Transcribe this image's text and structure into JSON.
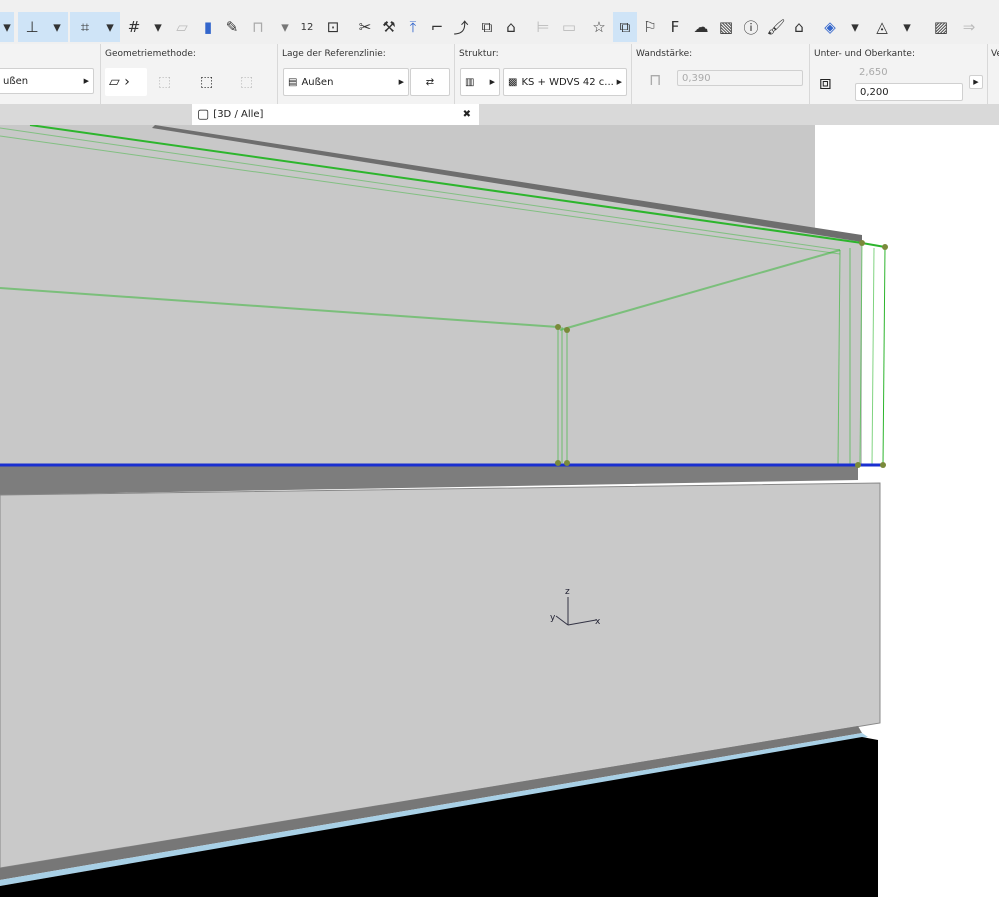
{
  "toolbar": {
    "icons": [
      "dropdown-arrow",
      "guide-line",
      "dropdown-arrow",
      "coordinate-input",
      "dropdown-arrow",
      "grid-snap",
      "dropdown-arrow",
      "plane",
      "wall-edit",
      "pen-edit",
      "lock",
      "dropdown-arrow",
      "measure",
      "group",
      "split",
      "adjust",
      "elevate",
      "corner",
      "curve",
      "resize",
      "home",
      "dim1",
      "dim2",
      "star",
      "layers",
      "flag",
      "flag-list",
      "cloud",
      "image",
      "info",
      "paint",
      "tag",
      "view-3d",
      "dropdown-arrow",
      "shape",
      "dropdown-arrow",
      "hatch",
      "arrow"
    ]
  },
  "infobox": {
    "ref_value": "ußen",
    "geometry_label": "Geometriemethode:",
    "refline_label": "Lage der Referenzlinie:",
    "refline_value": "Außen",
    "structure_label": "Struktur:",
    "structure_value": "KS + WDVS 42 c...",
    "thickness_label": "Wandstärke:",
    "thickness_value": "0,390",
    "edges_label": "Unter- und Oberkante:",
    "top_value": "2,650",
    "bottom_value": "0,200",
    "cut_label": "Ve"
  },
  "tab": {
    "title": "[3D / Alle]",
    "close": "✖"
  },
  "axes": {
    "z": "z",
    "y": "y",
    "x": "x"
  },
  "colors": {
    "selection": "#2db52d",
    "reference": "#1a2fd0",
    "wall": "#c8c8c8",
    "slab": "#808080"
  }
}
